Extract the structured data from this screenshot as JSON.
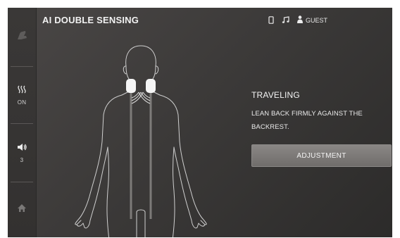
{
  "header": {
    "title": "AI DOUBLE SENSING",
    "status_icons": [
      "phone-icon",
      "music-icon"
    ],
    "user_label": "GUEST"
  },
  "sidebar": {
    "items": [
      {
        "name": "massage-chair",
        "icon": "chair-icon",
        "value": ""
      },
      {
        "name": "heat",
        "icon": "heat-icon",
        "value": "ON"
      },
      {
        "name": "volume",
        "icon": "volume-icon",
        "value": "3"
      },
      {
        "name": "home",
        "icon": "home-icon",
        "value": ""
      }
    ]
  },
  "main": {
    "status_title": "TRAVELING",
    "instruction": "LEAN BACK FIRMLY AGAINST THE BACKREST.",
    "button_label": "ADJUSTMENT"
  },
  "colors": {
    "background": "#3c3a39",
    "sidebar": "#353332",
    "button": "#7e7b79",
    "text": "#f2f2f2"
  }
}
